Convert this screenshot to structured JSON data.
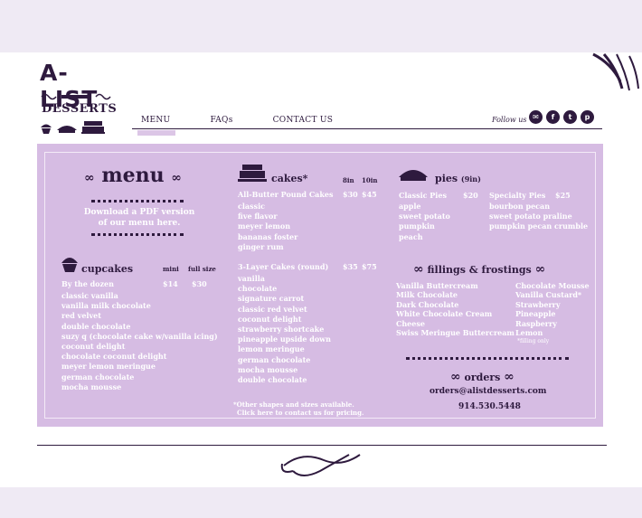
{
  "brand": {
    "title": "A-LIST",
    "subtitle": "DESSERTS"
  },
  "nav": {
    "items": [
      "MENU",
      "FAQs",
      "CONTACT US"
    ],
    "active": "MENU"
  },
  "social": {
    "label": "Follow us",
    "icons": [
      "email-icon",
      "facebook-icon",
      "twitter-icon",
      "pinterest-icon"
    ]
  },
  "menu": {
    "title": "menu",
    "pdf_link": "Download a PDF version of our menu here."
  },
  "cupcakes": {
    "title": "cupcakes",
    "col_mini": "mini",
    "col_full": "full size",
    "row_label": "By the dozen",
    "price_mini": "$14",
    "price_full": "$30",
    "items": [
      "classic vanilla",
      "vanilla milk chocolate",
      "red velvet",
      "double chocolate",
      "suzy q (chocolate cake w/vanilla icing)",
      "coconut delight",
      "chocolate coconut delight",
      "meyer lemon meringue",
      "german chocolate",
      "mocha mousse"
    ]
  },
  "cakes": {
    "title": "cakes*",
    "col_8": "8in",
    "col_10": "10in",
    "pound": {
      "label": "All-Butter Pound Cakes",
      "price_8": "$30",
      "price_10": "$45",
      "items": [
        "classic",
        "five flavor",
        "meyer lemon",
        "bananas foster",
        "ginger rum"
      ]
    },
    "layer": {
      "label": "3-Layer Cakes (round)",
      "price_8": "$35",
      "price_10": "$75",
      "items": [
        "vanilla",
        "chocolate",
        "signature carrot",
        "classic red velvet",
        "coconut delight",
        "strawberry shortcake",
        "pineapple upside down",
        "lemon meringue",
        "german chocolate",
        "mocha mousse",
        "double chocolate"
      ]
    },
    "note1": "*Other shapes and sizes available.",
    "note2": "Click here to contact us for pricing."
  },
  "pies": {
    "title": "pies",
    "size": "(9in)",
    "classic": {
      "label": "Classic Pies",
      "price": "$20",
      "items": [
        "apple",
        "sweet potato",
        "pumpkin",
        "peach"
      ]
    },
    "specialty": {
      "label": "Specialty Pies",
      "price": "$25",
      "items": [
        "bourbon pecan",
        "sweet potato praline",
        "pumpkin pecan crumble"
      ]
    }
  },
  "fillings": {
    "title": "fillings & frostings",
    "left": [
      "Vanilla Buttercream",
      "Milk Chocolate",
      "Dark Chocolate",
      "White Chocolate Cream",
      "Cheese",
      "Swiss Meringue Buttercream"
    ],
    "right": [
      "Chocolate Mousse",
      "Vanilla Custard*",
      "Strawberry",
      "Pineapple",
      "Raspberry",
      "Lemon"
    ],
    "note": "*filling only"
  },
  "orders": {
    "title": "orders",
    "email": "orders@alistdesserts.com",
    "phone": "914.530.5448"
  },
  "colors": {
    "accent": "#2e1a3e",
    "board": "#d6bce3",
    "band": "#efeaf4"
  }
}
